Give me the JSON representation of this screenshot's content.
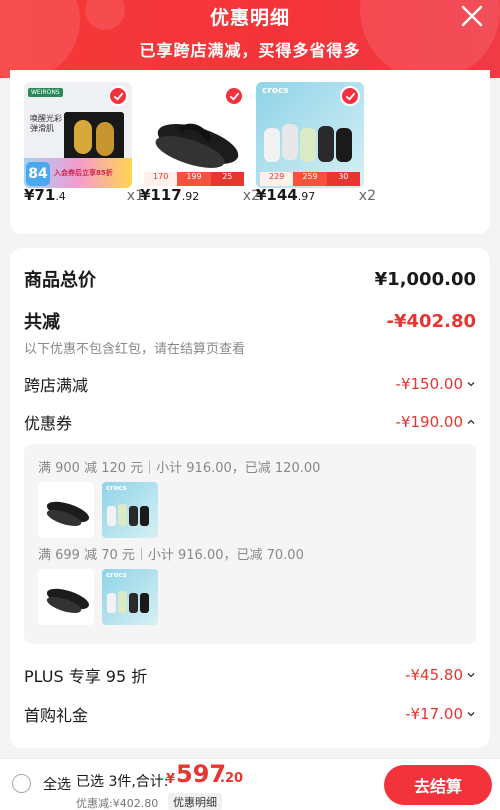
{
  "header": {
    "title": "优惠明细",
    "subtitle": "已享跨店满减，买得多省得多"
  },
  "products": [
    {
      "price_int": "¥71",
      "price_dec": ".4",
      "qty": "x1",
      "brand_text": "WEIRONS",
      "box_text": "唤醒光彩\n弹滑肌",
      "badge_number": "84",
      "badge_text": "入会券后立享85折"
    },
    {
      "price_int": "¥117",
      "price_dec": ".92",
      "qty": "x2",
      "tags": [
        "170",
        "199",
        "25"
      ]
    },
    {
      "price_int": "¥144",
      "price_dec": ".97",
      "qty": "x2",
      "brand_text": "crocs",
      "tags": [
        "229",
        "259",
        "30"
      ]
    }
  ],
  "summary": {
    "goods_total_label": "商品总价",
    "goods_total_value": "¥1,000.00",
    "total_reduce_label": "共减",
    "total_reduce_value": "-¥402.80",
    "note": "以下优惠不包含红包，请在结算页查看",
    "cross_store_label": "跨店满减",
    "cross_store_value": "-¥150.00",
    "coupon_label": "优惠券",
    "coupon_value": "-¥190.00",
    "coupon_lines": [
      "满 900 减 120 元｜小计 916.00，已减 120.00",
      "满 699 减 70 元｜小计 916.00，已减 70.00"
    ],
    "mini_brand": "crocs",
    "plus_label": "PLUS 专享 95 折",
    "plus_value": "-¥45.80",
    "first_gift_label": "首购礼金",
    "first_gift_value": "-¥17.00"
  },
  "bottom": {
    "select_all": "全选",
    "chosen": "已选 3件,合计:",
    "total_symbol": "¥",
    "total_int": "597",
    "total_dec": ".20",
    "reduced": "优惠减:¥402.80",
    "detail_link": "优惠明细",
    "checkout": "去结算"
  },
  "colors": {
    "accent_red": "#f5313d",
    "price_red": "#e8352f"
  }
}
